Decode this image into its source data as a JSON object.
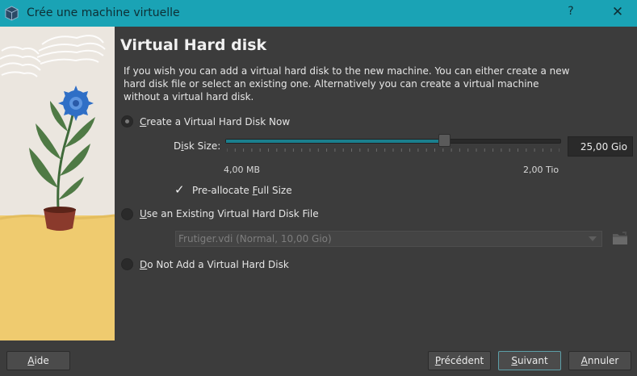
{
  "window": {
    "title": "Crée une machine virtuelle",
    "help_label": "?",
    "close_label": "X"
  },
  "page": {
    "heading": "Virtual Hard disk",
    "description": "If you wish you can add a virtual hard disk to the new machine. You can either create a new hard disk file or select an existing one. Alternatively you can create a virtual machine without a virtual hard disk."
  },
  "options": {
    "create_new": {
      "label_prefix": "",
      "mnemonic": "C",
      "label_rest": "reate a Virtual Hard Disk Now",
      "selected": true
    },
    "use_existing": {
      "label_prefix": "",
      "mnemonic": "U",
      "label_rest": "se an Existing Virtual Hard Disk File",
      "selected": false
    },
    "no_disk": {
      "label_prefix": "",
      "mnemonic": "D",
      "label_rest": "o Not Add a Virtual Hard Disk",
      "selected": false
    }
  },
  "disk_size": {
    "label_prefix": "D",
    "mnemonic": "i",
    "label_rest": "sk Size:",
    "value": "25,00 Gio",
    "min_label": "4,00 MB",
    "max_label": "2,00 Tio",
    "slider_fraction": 0.651
  },
  "preallocate": {
    "label_prefix": "Pre-allocate ",
    "mnemonic": "F",
    "label_rest": "ull Size",
    "checked": true,
    "check_glyph": "✓"
  },
  "existing_file": {
    "selected": "Frutiger.vdi (Normal, 10,00 Gio)"
  },
  "buttons": {
    "help": {
      "mnemonic": "A",
      "rest": "ide"
    },
    "back": {
      "prefix": "",
      "mnemonic": "P",
      "rest": "récédent"
    },
    "next": {
      "mnemonic": "S",
      "rest": "uivant"
    },
    "cancel": {
      "mnemonic": "A",
      "rest": "nnuler"
    }
  },
  "colors": {
    "titlebar": "#1aa3b5",
    "background": "#3c3c3c",
    "accent": "#1a7f8e"
  }
}
